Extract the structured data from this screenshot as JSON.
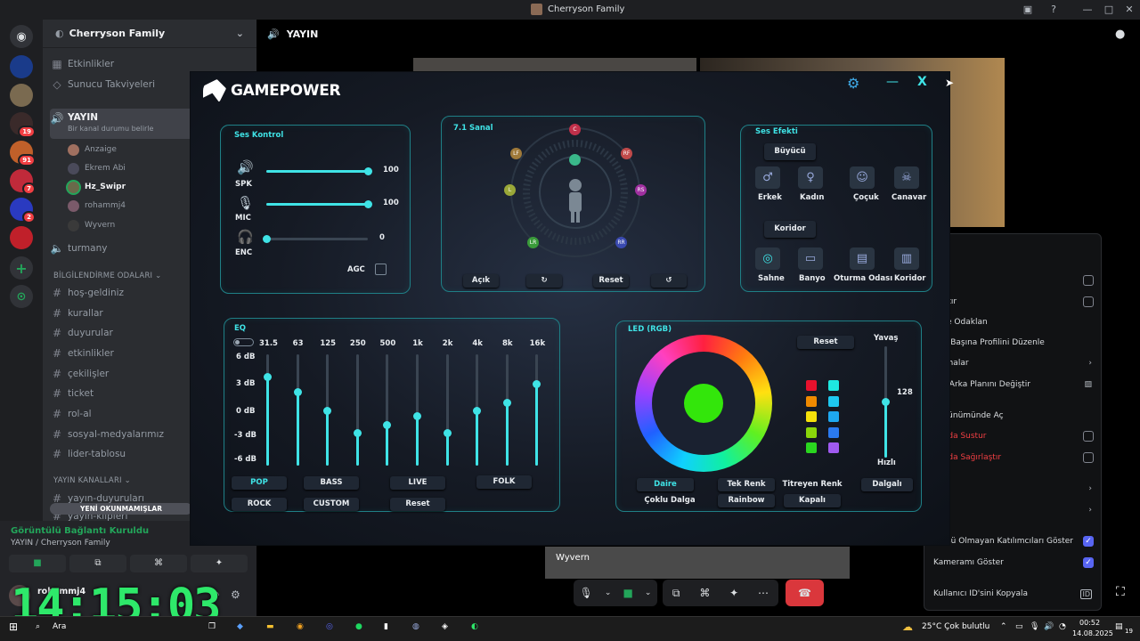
{
  "window": {
    "title": "Cherryson Family"
  },
  "servers": [
    {
      "badge": ""
    },
    {
      "badge": ""
    },
    {
      "badge": "19"
    },
    {
      "badge": "91"
    },
    {
      "badge": "7"
    },
    {
      "badge": "2"
    },
    {
      "badge": ""
    }
  ],
  "server": {
    "name": "Cherryson Family",
    "events": "Etkinlikler",
    "boosts": "Sunucu Takviyeleri"
  },
  "voice_channel": {
    "name": "YAYIN",
    "status": "Bir kanal durumu belirle"
  },
  "voice_users": [
    "Anzaige",
    "Ekrem Abi",
    "Hz_Swipr",
    "rohammj4",
    "Wyvern"
  ],
  "other_voice": "turmany",
  "category1": "BİLGİLENDİRME ODALARI",
  "channels": [
    "hoş-geldiniz",
    "kurallar",
    "duyurular",
    "etkinlikler",
    "çekilişler",
    "ticket",
    "rol-al",
    "sosyal-medyalarımız",
    "lider-tablosu"
  ],
  "category2": "YAYIN KANALLARI",
  "channels2": [
    "yayın-duyuruları",
    "yayın-klipleri"
  ],
  "unread": "YENİ OKUNMAMIŞLAR",
  "connection": {
    "status": "Görüntülü Bağlantı Kuruldu",
    "location": "YAYIN / Cherryson Family"
  },
  "user": {
    "name": "rohammj4"
  },
  "clock": "14:15:03",
  "main": {
    "header": "YAYIN",
    "cam_label": "Wyvern"
  },
  "gamepower": {
    "brand": "GAMEPOWER",
    "ses_kontrol": {
      "title": "Ses Kontrol",
      "spk_label": "SPK",
      "mic_label": "MIC",
      "enc_label": "ENC",
      "spk": 100,
      "mic": 100,
      "enc": 0,
      "agc": "AGC"
    },
    "virtual": {
      "title": "7.1 Sanal",
      "channels": [
        "C",
        "LF",
        "RF",
        "L",
        "RS",
        "LR",
        "RR"
      ],
      "on": "Açık",
      "reset": "Reset"
    },
    "effects": {
      "title": "Ses Efekti",
      "group1": "Büyücü",
      "items1": [
        "Erkek",
        "Kadın",
        "Çoçuk",
        "Canavar"
      ],
      "group2": "Koridor",
      "items2": [
        "Sahne",
        "Banyo",
        "Oturma Odası",
        "Koridor"
      ]
    },
    "eq": {
      "title": "EQ",
      "bands": [
        "31.5",
        "63",
        "125",
        "250",
        "500",
        "1k",
        "2k",
        "4k",
        "8k",
        "16k"
      ],
      "db_labels": [
        "6 dB",
        "3 dB",
        "0 dB",
        "-3 dB",
        "-6 dB"
      ],
      "values_db": [
        4.5,
        2.5,
        0,
        -3,
        -2,
        -0.8,
        -3,
        0,
        1,
        3.5
      ],
      "presets": [
        "POP",
        "BASS",
        "LIVE",
        "FOLK",
        "ROCK",
        "CUSTOM",
        "Reset"
      ]
    },
    "led": {
      "title": "LED (RGB)",
      "reset": "Reset",
      "slow": "Yavaş",
      "fast": "Hızlı",
      "speed": 128,
      "modes": [
        "Daire",
        "Tek Renk",
        "Titreyen Renk",
        "Dalgalı",
        "Çoklu Dalga",
        "Rainbow",
        "Kapalı"
      ],
      "center_color": "#33e60b",
      "swatches_left": [
        "#e8112d",
        "#f08a00",
        "#f5e10a",
        "#8ad60a",
        "#2ad61f"
      ],
      "swatches_right": [
        "#1ee8e0",
        "#1ec8f0",
        "#1ea8f0",
        "#2a7af0",
        "#a05af0"
      ]
    }
  },
  "context_menu": {
    "items": [
      "l",
      "ur",
      "rlaştır",
      "işiye Odaklan",
      "ucu Başına Profilini Düzenle",
      "alamalar",
      "ntü Arka Planını Değiştir",
      "Görünümünde Aç",
      "ucuda Sustur",
      "ucuda Sağırlaştır",
      "er",
      "",
      "ntüsü Olmayan Katılımcıları Göster",
      "Kameramı Göster",
      "Kullanıcı ID'sini Kopyala"
    ]
  },
  "taskbar": {
    "search": "Ara",
    "weather": "25°C  Çok bulutlu",
    "time": "00:52",
    "date": "14.08.2025",
    "notif": "19"
  },
  "colors": {
    "accent": "#3fe3e6",
    "discord_green": "#23a55a",
    "clock": "#2ee86a",
    "hangup": "#da373c"
  }
}
